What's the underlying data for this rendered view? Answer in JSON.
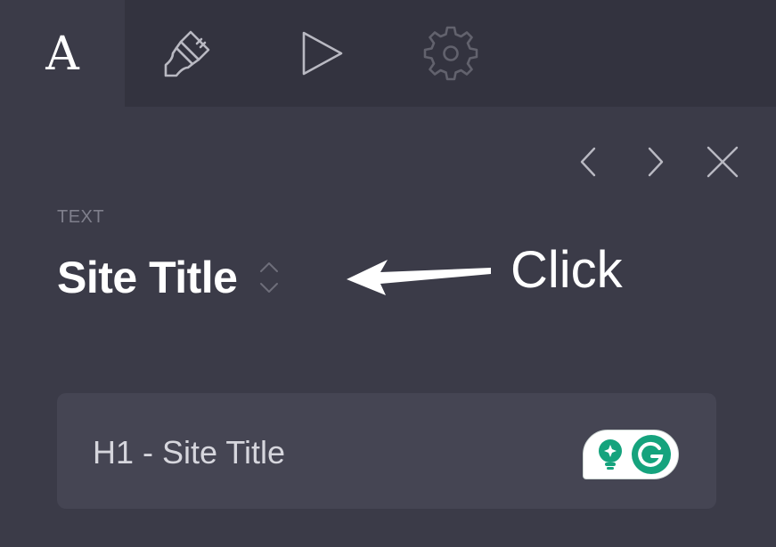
{
  "tabs": [
    {
      "id": "text",
      "label": "A",
      "icon": "text-format-icon",
      "active": true
    },
    {
      "id": "style",
      "icon": "paintbrush-icon",
      "active": false
    },
    {
      "id": "animation",
      "icon": "play-icon",
      "active": false
    },
    {
      "id": "settings",
      "icon": "gear-icon",
      "active": false
    }
  ],
  "nav": {
    "prev_icon": "chevron-left-icon",
    "next_icon": "chevron-right-icon",
    "close_icon": "close-icon"
  },
  "section": {
    "label": "TEXT",
    "title": "Site Title",
    "stepper_icon": "up-down-chevron-icon"
  },
  "annotation": {
    "text": "Click",
    "arrow_icon": "left-arrow-icon"
  },
  "field": {
    "value": "H1 - Site Title"
  },
  "grammarly": {
    "icons": [
      "lightbulb-icon",
      "grammarly-g-icon"
    ],
    "color": "#15a37d"
  },
  "colors": {
    "background": "#3b3b48",
    "tabbar": "#33333f",
    "field": "#454553",
    "icon_stroke": "#b9b9c2",
    "muted_label": "#7f7f8c"
  }
}
